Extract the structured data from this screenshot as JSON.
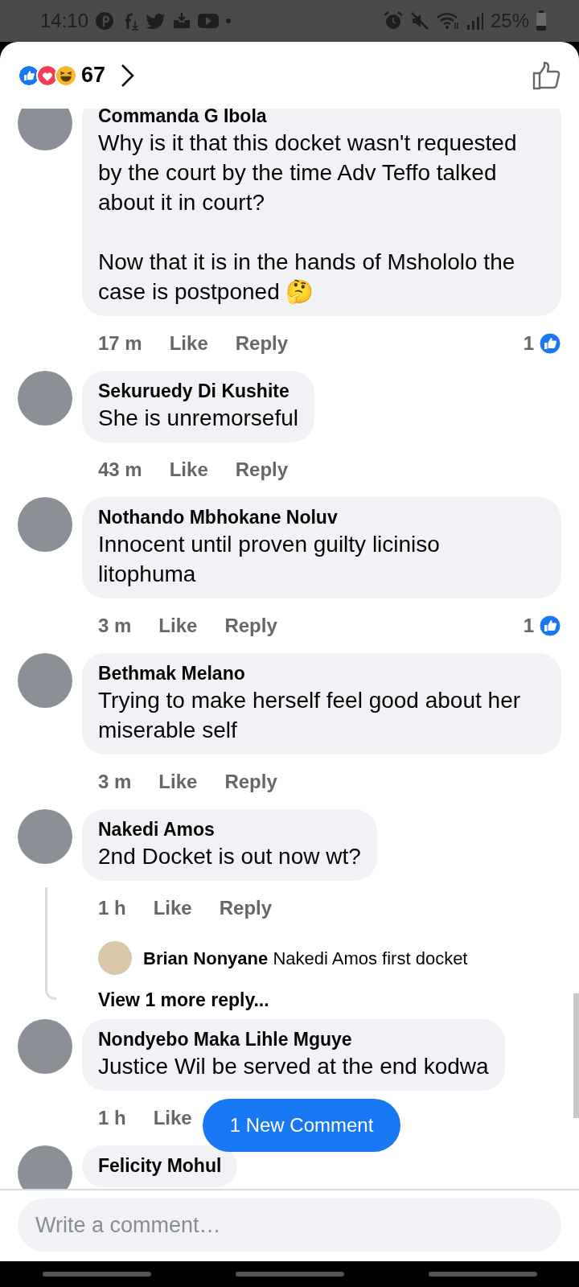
{
  "status_bar": {
    "time": "14:10",
    "battery": "25%"
  },
  "header": {
    "reaction_count": "67"
  },
  "comments": [
    {
      "name": "Commanda G Ibola",
      "text": "Why is it that this docket wasn't requested  by the court by the time Adv Teffo talked about it in court?\n\nNow that it is in the hands of Mshololo the case is postponed 🤔",
      "time": "17 m",
      "like": "Like",
      "reply": "Reply",
      "like_count": "1"
    },
    {
      "name": "Sekuruedy Di Kushite",
      "text": "She is unremorseful",
      "time": "43 m",
      "like": "Like",
      "reply": "Reply"
    },
    {
      "name": "Nothando Mbhokane Noluv",
      "text": "Innocent until proven guilty liciniso litophuma",
      "time": "3 m",
      "like": "Like",
      "reply": "Reply",
      "like_count": "1"
    },
    {
      "name": "Bethmak Melano",
      "text": "Trying to make herself feel good about her miserable self",
      "time": "3 m",
      "like": "Like",
      "reply": "Reply"
    },
    {
      "name": "Nakedi Amos",
      "text": "2nd Docket is out now wt?",
      "time": "1 h",
      "like": "Like",
      "reply": "Reply",
      "replies": [
        {
          "name": "Brian Nonyane",
          "text": "Nakedi Amos first docket"
        }
      ],
      "more_replies": "View 1 more reply..."
    },
    {
      "name": "Nondyebo Maka Lihle Mguye",
      "text": "Justice Wil be served at the end kodwa",
      "time": "1 h",
      "like": "Like"
    },
    {
      "name": "Felicity Mohul"
    }
  ],
  "new_comment_button": "1 New Comment",
  "composer": {
    "placeholder": "Write a comment…"
  }
}
